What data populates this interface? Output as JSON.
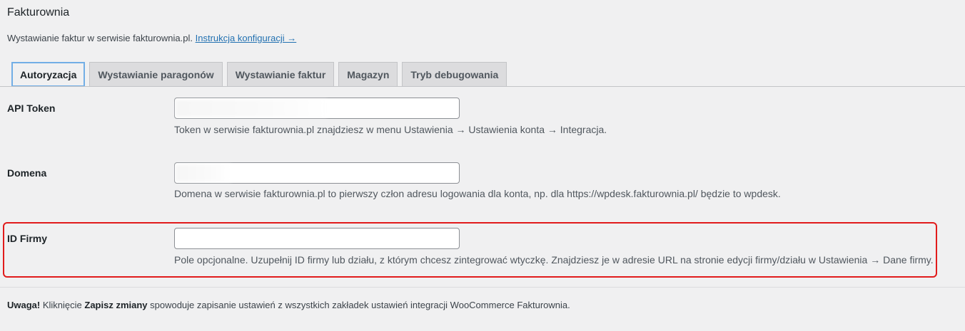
{
  "page": {
    "title": "Fakturownia",
    "intro_text": "Wystawianie faktur w serwisie fakturownia.pl.",
    "intro_link": "Instrukcja konfiguracji →"
  },
  "tabs": [
    {
      "label": "Autoryzacja",
      "active": true
    },
    {
      "label": "Wystawianie paragonów",
      "active": false
    },
    {
      "label": "Wystawianie faktur",
      "active": false
    },
    {
      "label": "Magazyn",
      "active": false
    },
    {
      "label": "Tryb debugowania",
      "active": false
    }
  ],
  "fields": {
    "api_token": {
      "label": "API Token",
      "value": "",
      "description": "Token w serwisie fakturownia.pl znajdziesz w menu Ustawienia → Ustawienia konta → Integracja."
    },
    "domena": {
      "label": "Domena",
      "value": "",
      "description": "Domena w serwisie fakturownia.pl to pierwszy człon adresu logowania dla konta, np. dla https://wpdesk.fakturownia.pl/ będzie to wpdesk."
    },
    "id_firmy": {
      "label": "ID Firmy",
      "value": "",
      "description": "Pole opcjonalne. Uzupełnij ID firmy lub działu, z którym chcesz zintegrować wtyczkę. Znajdziesz je w adresie URL na stronie edycji firmy/działu w Ustawienia → Dane firmy."
    }
  },
  "footer_note": {
    "bold_prefix": "Uwaga!",
    "text_1": " Kliknięcie ",
    "bold_action": "Zapisz zmiany",
    "text_2": " spowoduje zapisanie ustawień z wszystkich zakładek ustawień integracji WooCommerce Fakturownia."
  },
  "colors": {
    "background": "#f0f0f1",
    "link": "#2271b1",
    "highlight": "#e11b1b",
    "active_tab_border": "#72aee6"
  }
}
